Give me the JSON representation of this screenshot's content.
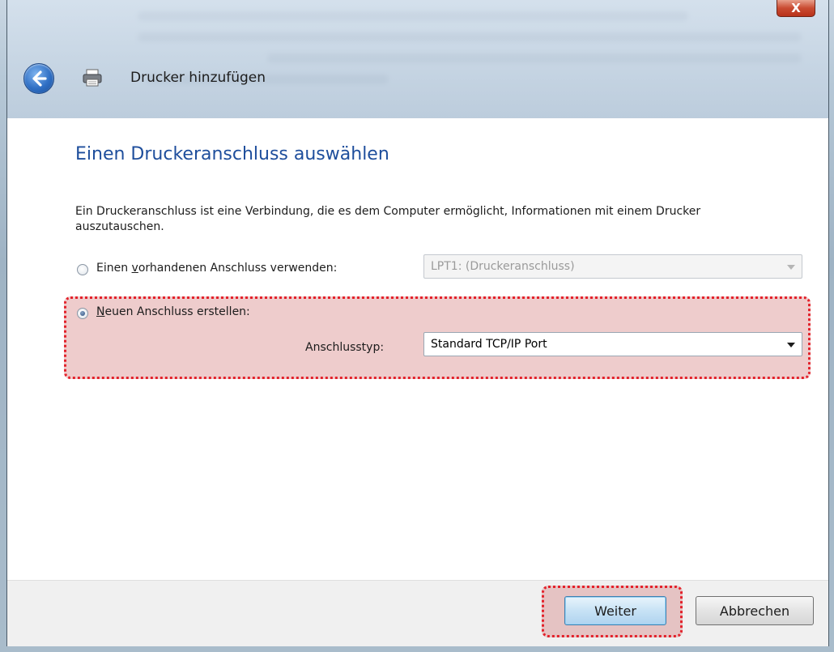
{
  "window": {
    "title": "Drucker hinzufügen",
    "close_label": "X"
  },
  "page": {
    "heading": "Einen Druckeranschluss auswählen",
    "description": "Ein Druckeranschluss ist eine Verbindung, die es dem Computer ermöglicht, Informationen mit einem Drucker auszutauschen."
  },
  "options": {
    "existing_port": {
      "label_pre": "Einen ",
      "label_underlined": "v",
      "label_post": "orhandenen Anschluss verwenden:",
      "selected": false,
      "select_value": "LPT1: (Druckeranschluss)"
    },
    "new_port": {
      "label_underlined": "N",
      "label_post": "euen Anschluss erstellen:",
      "selected": true,
      "type_label": "Anschlusstyp:",
      "type_value": "Standard TCP/IP Port"
    }
  },
  "footer": {
    "next_label": "Weiter",
    "cancel_label": "Abbrechen"
  },
  "colors": {
    "heading": "#1e4e9c",
    "highlight_border": "#e3222b",
    "highlight_fill": "#d27878"
  },
  "icons": {
    "back": "back-arrow-icon",
    "printer": "printer-icon",
    "close": "close-icon",
    "dropdown": "chevron-down-icon"
  }
}
